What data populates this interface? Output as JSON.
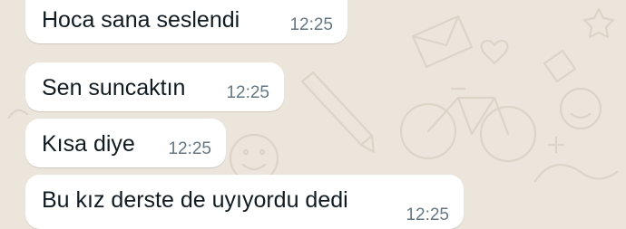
{
  "colors": {
    "wallpaper": "#ece5dc",
    "wallpaper_doodle": "#ddd4c8",
    "bubble_background": "#ffffff",
    "message_text": "#111b21",
    "timestamp_text": "#667781"
  },
  "wallpaper_icons": [
    "envelope-icon",
    "bicycle-icon",
    "pencil-icon",
    "face-icon",
    "heart-icon",
    "star-icon",
    "smile-icon"
  ],
  "messages": [
    {
      "text": "Hoca sana seslendi",
      "time": "12:25"
    },
    {
      "text": "Sen suncaktın",
      "time": "12:25"
    },
    {
      "text": "Kısa diye",
      "time": "12:25"
    },
    {
      "text": "Bu kız derste de uyıyordu dedi",
      "time": "12:25"
    }
  ]
}
